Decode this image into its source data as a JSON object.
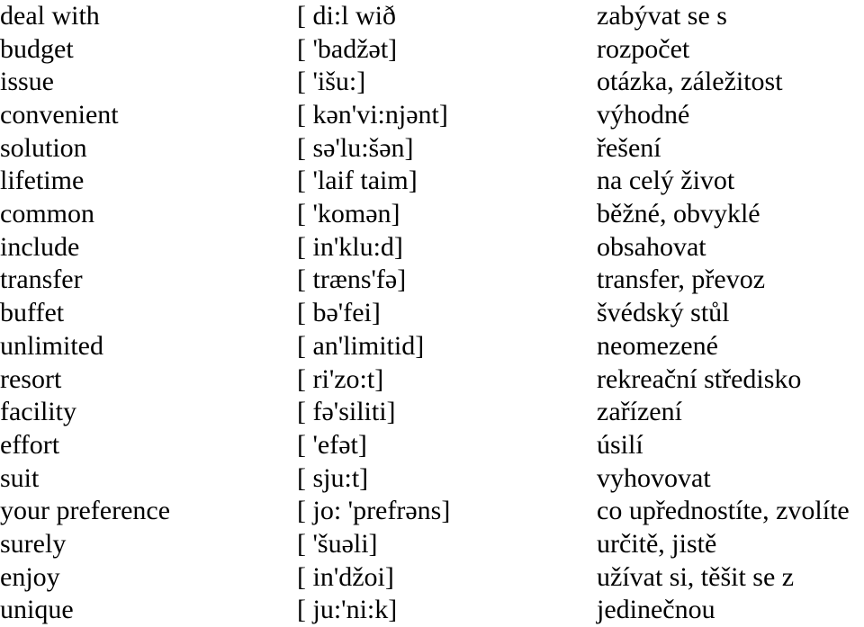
{
  "document": {
    "type": "vocabulary-list",
    "language_pair": "English – Czech",
    "background_color": "#ffffff",
    "text_color": "#000000",
    "row_count": 19,
    "columns": [
      {
        "key": "term",
        "role": "english-term"
      },
      {
        "key": "phonetic",
        "role": "phonetic-transcription"
      },
      {
        "key": "translation",
        "role": "czech-translation"
      }
    ]
  },
  "rows": [
    {
      "term": "deal with",
      "phonetic": "[ di:l wið",
      "translation": "zabývat se s"
    },
    {
      "term": "budget",
      "phonetic": "[ 'badžət]",
      "translation": "rozpočet"
    },
    {
      "term": "issue",
      "phonetic": "[ 'išu:]",
      "translation": "otázka, záležitost"
    },
    {
      "term": "convenient",
      "phonetic": "[ kən'vi:njənt]",
      "translation": "výhodné"
    },
    {
      "term": "solution",
      "phonetic": "[ sə'lu:šən]",
      "translation": "řešení"
    },
    {
      "term": "lifetime",
      "phonetic": "[ 'laif taim]",
      "translation": "na celý život"
    },
    {
      "term": "common",
      "phonetic": "[ 'komən]",
      "translation": "běžné, obvyklé"
    },
    {
      "term": "include",
      "phonetic": "[ in'klu:d]",
      "translation": "obsahovat"
    },
    {
      "term": "transfer",
      "phonetic": "[ træns'fə]",
      "translation": "transfer, převoz"
    },
    {
      "term": "buffet",
      "phonetic": "[ bə'fei]",
      "translation": "švédský stůl"
    },
    {
      "term": "unlimited",
      "phonetic": "[ an'limitid]",
      "translation": "neomezené"
    },
    {
      "term": "resort",
      "phonetic": "[ ri'zo:t]",
      "translation": "rekreační středisko"
    },
    {
      "term": "facility",
      "phonetic": "[ fə'siliti]",
      "translation": "zařízení"
    },
    {
      "term": "effort",
      "phonetic": "[ 'efət]",
      "translation": "úsilí"
    },
    {
      "term": "suit",
      "phonetic": "[ sju:t]",
      "translation": "vyhovovat"
    },
    {
      "term": "your preference",
      "phonetic": "[ jo: 'prefrəns]",
      "translation": "co upřednostíte, zvolíte"
    },
    {
      "term": "surely",
      "phonetic": "[ 'šuəli]",
      "translation": "určitě, jistě"
    },
    {
      "term": "enjoy",
      "phonetic": "[ in'džoi]",
      "translation": "užívat si, těšit se z"
    },
    {
      "term": "unique",
      "phonetic": "[ ju:'ni:k]",
      "translation": "jedinečnou"
    }
  ]
}
